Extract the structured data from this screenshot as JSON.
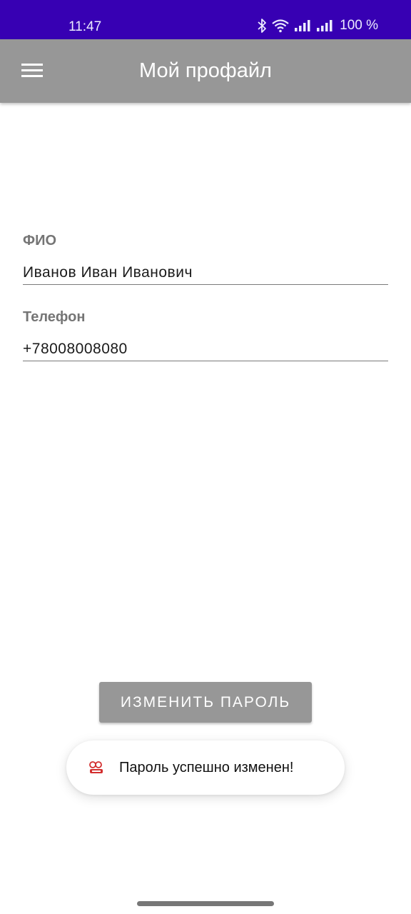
{
  "status_bar": {
    "time": "11:47",
    "battery": "100 %",
    "icons": [
      "bluetooth-icon",
      "wifi-icon",
      "signal-icon",
      "signal-icon"
    ]
  },
  "app_bar": {
    "title": "Мой профайл",
    "menu_icon": "menu-icon"
  },
  "profile": {
    "fio_label": "ФИО",
    "fio_value": "Иванов Иван Иванович",
    "phone_label": "Телефон",
    "phone_value": "+78008008080"
  },
  "actions": {
    "change_password_label": "ИЗМЕНИТЬ ПАРОЛЬ"
  },
  "toast": {
    "message": "Пароль успешно изменен!",
    "icon": "app-logo-icon"
  },
  "colors": {
    "status_bar": "#3700b3",
    "app_bar": "#979797",
    "button": "#979797"
  }
}
